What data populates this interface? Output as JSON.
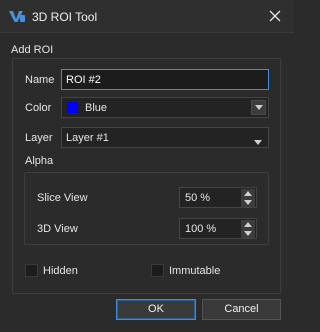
{
  "window": {
    "title": "3D ROI Tool",
    "logo_icon": "app-logo-icon",
    "close_icon": "close-icon"
  },
  "form": {
    "section_title": "Add ROI",
    "name": {
      "label": "Name",
      "value": "ROI #2"
    },
    "color": {
      "label": "Color",
      "value": "Blue",
      "swatch": "#0000ff"
    },
    "layer": {
      "label": "Layer",
      "value": "Layer #1"
    },
    "alpha": {
      "title": "Alpha",
      "slice_view": {
        "label": "Slice View",
        "value": "50 %"
      },
      "view_3d": {
        "label": "3D View",
        "value": "100 %"
      }
    },
    "hidden": {
      "label": "Hidden",
      "checked": false
    },
    "immutable": {
      "label": "Immutable",
      "checked": false
    }
  },
  "buttons": {
    "ok": "OK",
    "cancel": "Cancel"
  },
  "colors": {
    "accent": "#3d8ee0",
    "background": "#2b2b2b"
  }
}
